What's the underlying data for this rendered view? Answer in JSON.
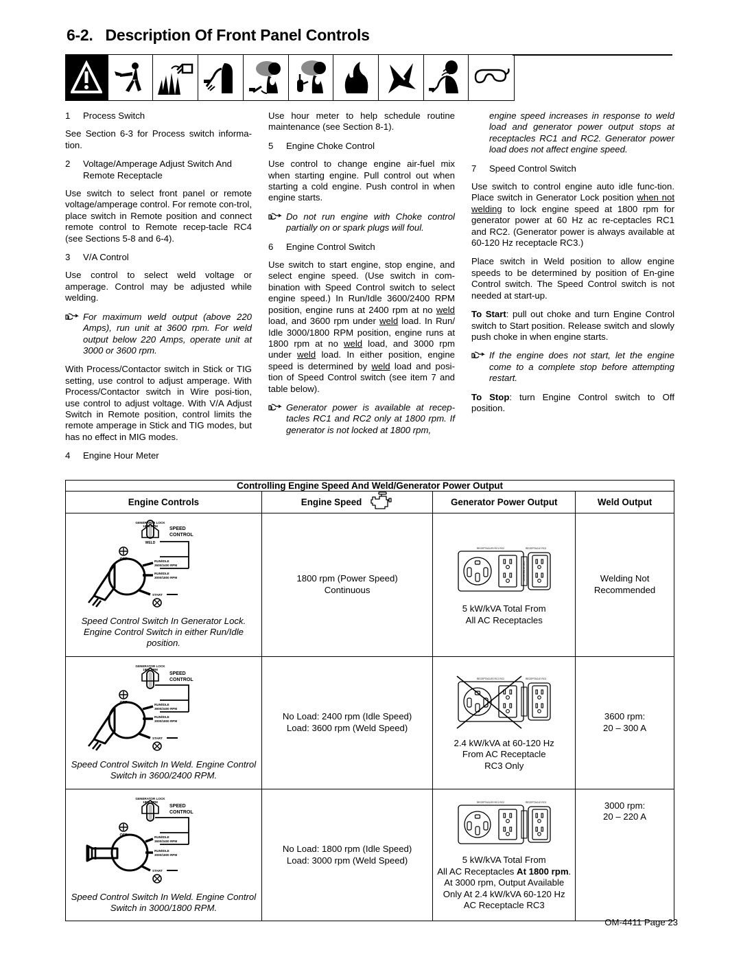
{
  "heading": {
    "number": "6-2.",
    "title": "Description Of Front Panel Controls"
  },
  "safety_icons": [
    "warning-triangle-icon",
    "electric-shock-icon",
    "arc-rays-burn-icon",
    "welding-sparks-fire-icon",
    "welding-fumes-icon",
    "engine-exhaust-fumes-icon",
    "fire-hazard-icon",
    "moving-parts-icon",
    "arc-welding-radiation-icon",
    "wear-eye-protection-icon"
  ],
  "columns": {
    "col1": {
      "item1_num": "1",
      "item1_label": "Process Switch",
      "p1": "See Section 6-3 for Process switch informa-tion.",
      "item2_num": "2",
      "item2_label": "Voltage/Amperage Adjust Switch And Remote Receptacle",
      "p2": "Use switch to select front panel or remote voltage/amperage control. For remote con-trol, place switch in Remote position and connect remote control to Remote recep-tacle RC4 (see Sections 5-8 and 6-4).",
      "item3_num": "3",
      "item3_label": "V/A Control",
      "p3": "Use control to select weld voltage or amperage. Control may be adjusted while welding.",
      "note1": "For maximum weld output (above 220 Amps), run unit at 3600 rpm. For weld output below 220 Amps, operate unit at 3000 or 3600 rpm.",
      "p4": "With Process/Contactor switch in Stick or TIG setting, use control to adjust amperage. With Process/Contactor switch in  Wire posi-tion, use control to adjust voltage. With V/A Adjust Switch in Remote position, control limits the remote amperage in Stick and TIG modes, but has no effect in MIG modes.",
      "item4_num": "4",
      "item4_label": "Engine Hour Meter"
    },
    "col2": {
      "p1": "Use hour meter to help schedule routine maintenance (see Section 8-1).",
      "item5_num": "5",
      "item5_label": "Engine Choke Control",
      "p2": "Use control to change engine air-fuel mix when starting engine. Pull control out when starting a cold engine. Push control in when engine starts.",
      "note1": "Do not run engine with Choke control partially on or spark plugs will foul.",
      "item6_num": "6",
      "item6_label": "Engine Control Switch",
      "p3_a": "Use switch to start engine, stop engine, and select engine speed. (Use switch in com-bination with Speed Control switch to select engine speed.) In Run/Idle 3600/2400 RPM position, engine runs at 2400 rpm at no ",
      "p3_u1": "weld",
      "p3_b": " load, and 3600 rpm under ",
      "p3_u2": "weld",
      "p3_c": " load. In Run/ Idle 3000/1800 RPM position, engine runs at 1800 rpm at no ",
      "p3_u3": "weld",
      "p3_d": " load, and 3000 rpm under ",
      "p3_u4": "weld",
      "p3_e": " load. In either position, engine speed is determined by ",
      "p3_u5": "weld",
      "p3_f": " load and posi-tion of Speed Control switch (see item 7 and table below).",
      "note2": "Generator power is available at recep-tacles RC1 and RC2 only at 1800 rpm. If generator is not locked at 1800 rpm,"
    },
    "col3": {
      "note_cont": "engine speed increases in response to weld load and generator power output stops at receptacles RC1 and RC2. Generator power load does not affect engine speed.",
      "item7_num": "7",
      "item7_label": "Speed Control Switch",
      "p1_a": "Use switch to control engine auto idle func-tion. Place switch in Generator Lock position ",
      "p1_u1": "when not welding",
      "p1_b": " to lock engine speed at 1800 rpm for generator power at 60 Hz ac re-ceptacles RC1 and RC2. (Generator power is always available at 60-120 Hz receptacle RC3.)",
      "p2": "Place switch in Weld position to allow engine speeds to be determined by position of En-gine Control switch. The Speed Control switch is not needed at start-up.",
      "p3_bold": "To Start",
      "p3_rest": ": pull out choke and turn Engine Control switch to Start position. Release switch and slowly push choke in when engine starts.",
      "note1": "If the engine does not start, let the engine come to a complete stop before attempting restart.",
      "p4_bold": "To Stop",
      "p4_rest": ": turn Engine Control switch to Off position."
    }
  },
  "table": {
    "title": "Controlling Engine Speed And Weld/Generator Power Output",
    "headers": {
      "engine_controls": "Engine Controls",
      "engine_speed": "Engine Speed",
      "engine_speed_icon": "engine-block-icon",
      "generator_power_output": "Generator Power Output",
      "weld_output": "Weld Output"
    },
    "diagram_labels": {
      "generator_lock": "GENERATOR LOCK",
      "generator_lock_rpm": "1800 RPM",
      "speed_control_l1": "SPEED",
      "speed_control_l2": "CONTROL",
      "weld": "WELD",
      "off": "OFF",
      "run_idle_1_l1": "RUN/IDLE",
      "run_idle_1_l2": "3600/2400 RPM",
      "run_idle_2_l1": "RUN/IDLE",
      "run_idle_2_l2": "3000/1800 RPM",
      "start": "START"
    },
    "rows": [
      {
        "controls_caption": "Speed Control Switch In Generator Lock. Engine  Control Switch in either Run/Idle position.",
        "engine_speed": [
          "1800 rpm (Power Speed)",
          "Continuous"
        ],
        "generator_power": [
          "5 kW/kVA Total From",
          "All AC Receptacles"
        ],
        "generator_power_bold": "",
        "generator_power_extra": [],
        "weld_output": [
          "Welding Not",
          "Recommended"
        ],
        "receptacle_crossed": false
      },
      {
        "controls_caption": "Speed Control Switch In Weld. Engine  Control Switch in 3600/2400 RPM.",
        "engine_speed": [
          "No Load: 2400 rpm (Idle Speed)",
          "Load: 3600 rpm (Weld Speed)"
        ],
        "generator_power": [
          "2.4 kW/kVA at 60-120 Hz",
          "From AC Receptacle",
          "RC3 Only"
        ],
        "generator_power_bold": "",
        "generator_power_extra": [],
        "weld_output": [
          "3600 rpm:",
          "20 – 300 A"
        ],
        "receptacle_crossed": true
      },
      {
        "controls_caption": "Speed Control Switch In Weld. Engine  Control Switch in 3000/1800 RPM.",
        "engine_speed": [
          "No Load: 1800 rpm (Idle Speed)",
          "Load: 3000 rpm (Weld Speed)"
        ],
        "generator_power": [
          "5 kW/kVA Total From",
          "All AC Receptacles "
        ],
        "generator_power_bold": "At 1800 rpm",
        "generator_power_extra": [
          "At 3000 rpm, Output Available",
          "Only At 2.4 kW/kVA 60-120 Hz",
          "AC Receptacle RC3"
        ],
        "weld_output": [
          "3000 rpm:",
          "20 – 220 A"
        ],
        "receptacle_crossed": false
      }
    ]
  },
  "footer": {
    "text": "OM-4411 Page 23"
  }
}
